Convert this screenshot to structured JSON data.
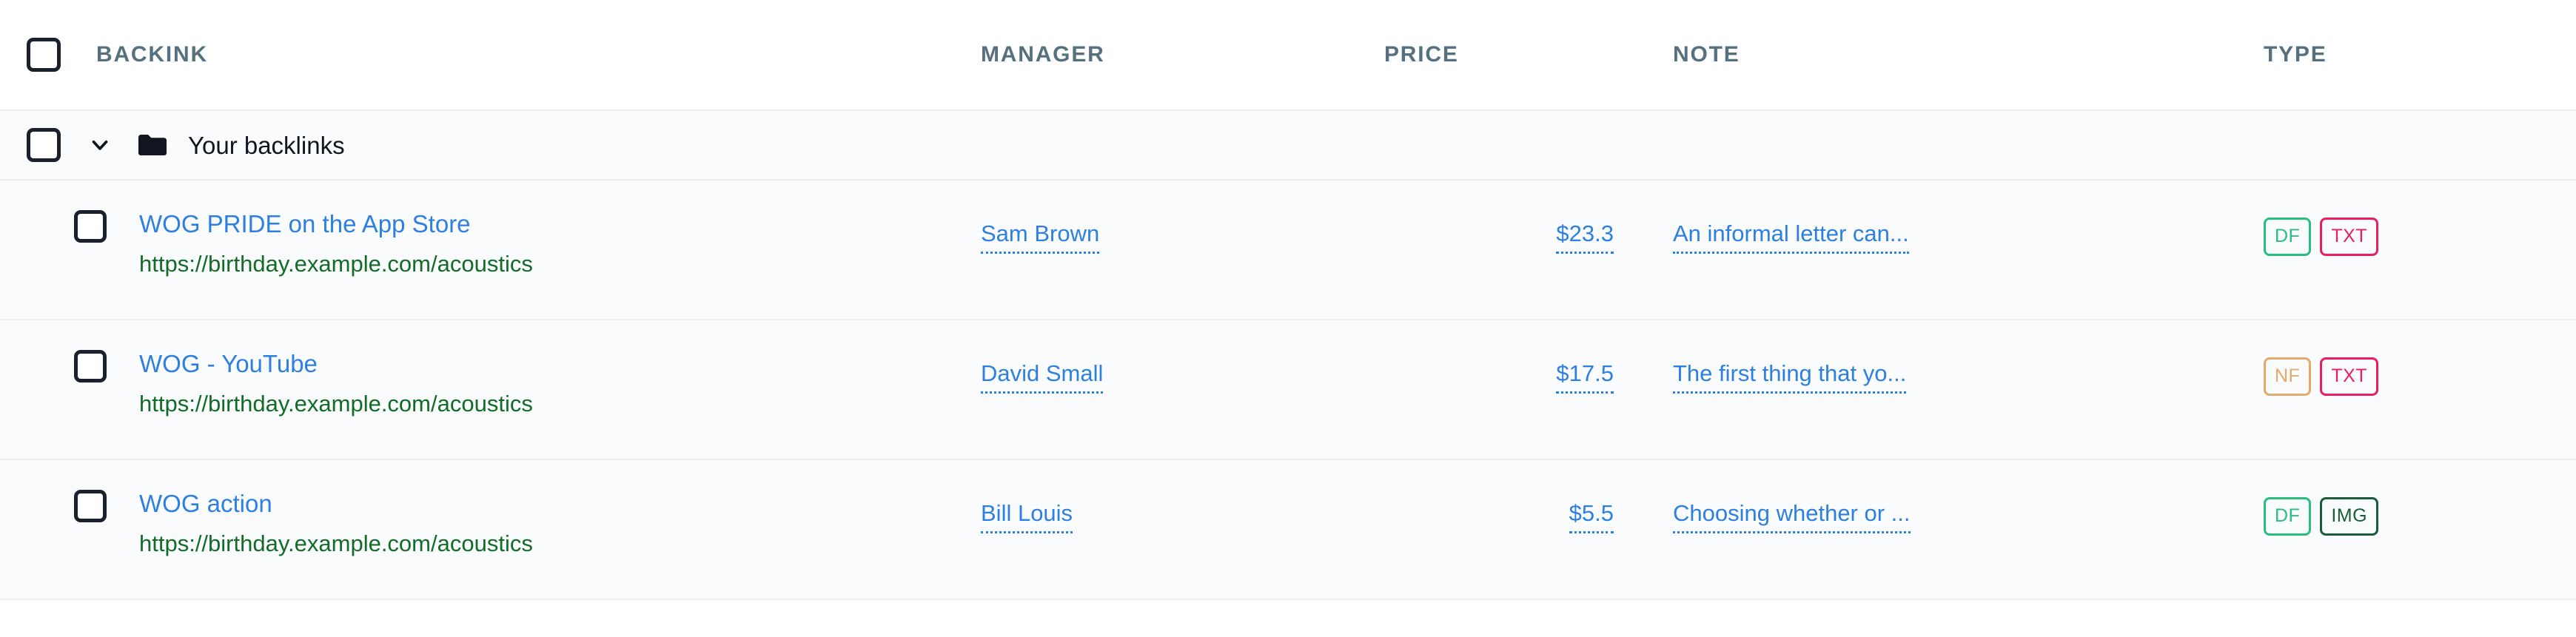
{
  "colors": {
    "link_blue": "#2d7fe0",
    "url_green": "#136b28",
    "header_gray": "#56707f",
    "row_bg": "#fafbfc",
    "divider": "#eceff3",
    "checkbox_border": "#1b212c",
    "badge_df": "#2bbd7e",
    "badge_nf": "#e3ab69",
    "badge_txt": "#ea1e5f",
    "badge_img": "#1a5c3a"
  },
  "header": {
    "columns": [
      {
        "label": "BACKINK",
        "key": "backlink"
      },
      {
        "label": "MANAGER",
        "key": "manager"
      },
      {
        "label": "PRICE",
        "key": "price"
      },
      {
        "label": "NOTE",
        "key": "note"
      },
      {
        "label": "TYPE",
        "key": "type"
      }
    ]
  },
  "folder": {
    "name": "Your backlinks",
    "expanded": true,
    "chevron_icon": "chevron-down-icon",
    "folder_icon": "folder-filled-icon",
    "checked": false
  },
  "rows": [
    {
      "checked": false,
      "title": "WOG PRIDE on the App Store",
      "url": "https://birthday.example.com/acoustics",
      "manager": "Sam Brown",
      "price": "$23.3",
      "note": "An informal letter can...",
      "types": [
        {
          "label": "DF",
          "color": "#2bbd7e"
        },
        {
          "label": "TXT",
          "color": "#ea1e5f"
        }
      ]
    },
    {
      "checked": false,
      "title": "WOG - YouTube",
      "url": "https://birthday.example.com/acoustics",
      "manager": "David Small",
      "price": "$17.5",
      "note": "The first thing that yo...",
      "types": [
        {
          "label": "NF",
          "color": "#e3ab69"
        },
        {
          "label": "TXT",
          "color": "#ea1e5f"
        }
      ]
    },
    {
      "checked": false,
      "title": "WOG action",
      "url": "https://birthday.example.com/acoustics",
      "manager": "Bill Louis",
      "price": "$5.5",
      "note": "Choosing whether or ...",
      "types": [
        {
          "label": "DF",
          "color": "#2bbd7e"
        },
        {
          "label": "IMG",
          "color": "#1a5c3a"
        }
      ]
    }
  ],
  "overlay": {
    "edit_icon": "edit-pencil-icon"
  }
}
